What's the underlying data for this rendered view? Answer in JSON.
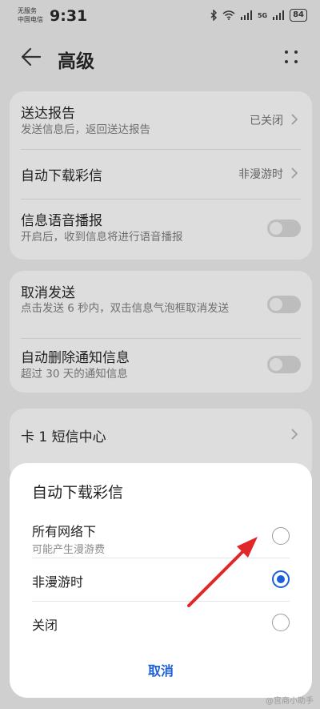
{
  "status_bar": {
    "carrier_line1": "无服务",
    "carrier_line2": "中国电信",
    "time": "9:31",
    "icons": [
      "bluetooth-icon",
      "wifi-icon",
      "signal-icon",
      "signal-icon"
    ],
    "signal_text": "5G",
    "battery": "84"
  },
  "header": {
    "title": "高级"
  },
  "group1": {
    "delivery_report": {
      "title": "送达报告",
      "subtitle": "发送信息后，返回送达报告",
      "value": "已关闭"
    },
    "auto_download": {
      "title": "自动下载彩信",
      "value": "非漫游时"
    },
    "voice_broadcast": {
      "title": "信息语音播报",
      "subtitle": "开启后，收到信息将进行语音播报",
      "enabled": false
    }
  },
  "group2": {
    "cancel_send": {
      "title": "取消发送",
      "subtitle": "点击发送 6 秒内，双击信息气泡框取消发送",
      "enabled": false
    },
    "auto_delete": {
      "title": "自动删除通知信息",
      "subtitle": "超过 30 天的通知信息",
      "enabled": false
    }
  },
  "group3": {
    "sms_center": {
      "title": "卡 1 短信中心"
    }
  },
  "dialog": {
    "title": "自动下载彩信",
    "options": [
      {
        "label": "所有网络下",
        "sublabel": "可能产生漫游费",
        "selected": false
      },
      {
        "label": "非漫游时",
        "selected": true
      },
      {
        "label": "关闭",
        "selected": false
      }
    ],
    "cancel_label": "取消"
  },
  "colors": {
    "accent": "#1a5fd6",
    "annotation_arrow": "#e0272a"
  },
  "watermark": "@宫商小助手"
}
